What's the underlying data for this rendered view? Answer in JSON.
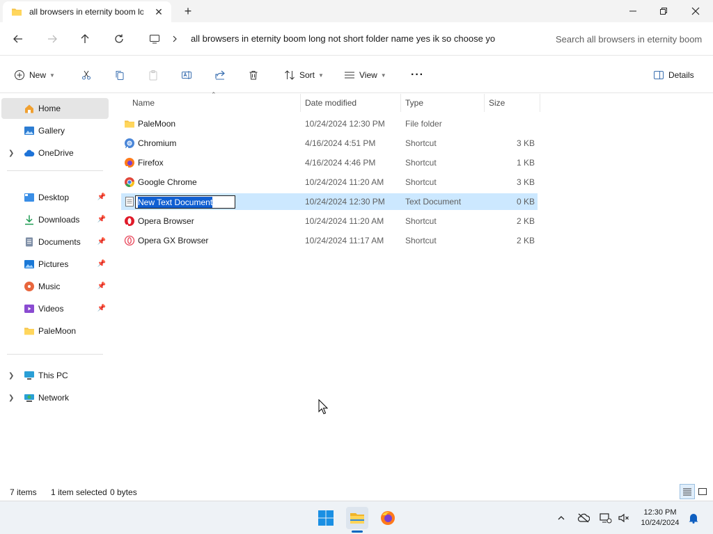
{
  "window": {
    "tab_title": "all browsers in eternity boom long not short folder name yes ik so choose yo",
    "tab_close": "✕",
    "new_tab": "+"
  },
  "address": {
    "path": "all browsers in eternity boom long not short folder name yes ik so choose yo",
    "search_placeholder": "Search all browsers in eternity boom long not short folder name yes ik so choose yo"
  },
  "toolbar": {
    "new_label": "New",
    "sort_label": "Sort",
    "view_label": "View",
    "details_label": "Details",
    "more_label": "···"
  },
  "sidebar": {
    "home": "Home",
    "gallery": "Gallery",
    "onedrive": "OneDrive",
    "desktop": "Desktop",
    "downloads": "Downloads",
    "documents": "Documents",
    "pictures": "Pictures",
    "music": "Music",
    "videos": "Videos",
    "palemoon": "PaleMoon",
    "this_pc": "This PC",
    "network": "Network"
  },
  "columns": {
    "name": "Name",
    "date": "Date modified",
    "type": "Type",
    "size": "Size"
  },
  "files": [
    {
      "name": "PaleMoon",
      "date": "10/24/2024 12:30 PM",
      "type": "File folder",
      "size": "",
      "icon": "folder-icon"
    },
    {
      "name": "Chromium",
      "date": "4/16/2024 4:51 PM",
      "type": "Shortcut",
      "size": "3 KB",
      "icon": "chromium-icon"
    },
    {
      "name": "Firefox",
      "date": "4/16/2024 4:46 PM",
      "type": "Shortcut",
      "size": "1 KB",
      "icon": "firefox-icon"
    },
    {
      "name": "Google Chrome",
      "date": "10/24/2024 11:20 AM",
      "type": "Shortcut",
      "size": "3 KB",
      "icon": "chrome-icon"
    },
    {
      "name": "New Text Document",
      "date": "10/24/2024 12:30 PM",
      "type": "Text Document",
      "size": "0 KB",
      "icon": "text-document-icon"
    },
    {
      "name": "Opera Browser",
      "date": "10/24/2024 11:20 AM",
      "type": "Shortcut",
      "size": "2 KB",
      "icon": "opera-icon"
    },
    {
      "name": "Opera GX Browser",
      "date": "10/24/2024 11:17 AM",
      "type": "Shortcut",
      "size": "2 KB",
      "icon": "opera-gx-icon"
    }
  ],
  "status": {
    "item_count": "7 items",
    "selection": "1 item selected",
    "selection_size": "0 bytes"
  },
  "taskbar": {
    "time": "12:30 PM",
    "date": "10/24/2024"
  },
  "colors": {
    "selection": "#cce8ff",
    "rename_highlight": "#0f5fd2",
    "accent": "#0067c0"
  }
}
